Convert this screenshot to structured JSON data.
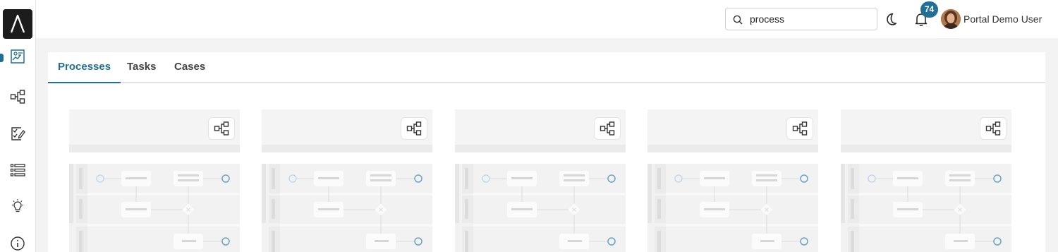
{
  "sidebar": {
    "items": [
      {
        "name": "dashboard",
        "icon": "dashboard-icon",
        "active": true
      },
      {
        "name": "processes",
        "icon": "process-icon",
        "active": false
      },
      {
        "name": "tasks",
        "icon": "task-check-icon",
        "active": false
      },
      {
        "name": "cases",
        "icon": "list-icon",
        "active": false
      },
      {
        "name": "ideas",
        "icon": "lightbulb-icon",
        "active": false
      },
      {
        "name": "info",
        "icon": "info-icon",
        "active": false
      }
    ]
  },
  "header": {
    "search": {
      "value": "process",
      "placeholder": ""
    },
    "notification_count": "74",
    "user_name": "Portal Demo User"
  },
  "tabs": [
    {
      "label": "Processes",
      "active": true
    },
    {
      "label": "Tasks",
      "active": false
    },
    {
      "label": "Cases",
      "active": false
    }
  ],
  "cards_count": 5,
  "colors": {
    "accent": "#1f6f96",
    "logo_bg": "#1c1c1c"
  }
}
